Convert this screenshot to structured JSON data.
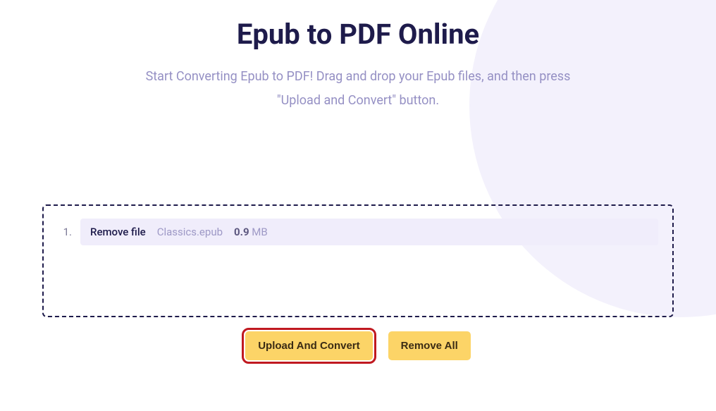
{
  "header": {
    "title": "Epub to PDF Online",
    "subtitle": "Start Converting Epub to PDF! Drag and drop your Epub files, and then press \"Upload and Convert\" button."
  },
  "files": [
    {
      "index": "1.",
      "remove_label": "Remove file",
      "name": "Classics.epub",
      "size_number": "0.9",
      "size_unit": " MB"
    }
  ],
  "buttons": {
    "upload_convert": "Upload And Convert",
    "remove_all": "Remove All"
  }
}
